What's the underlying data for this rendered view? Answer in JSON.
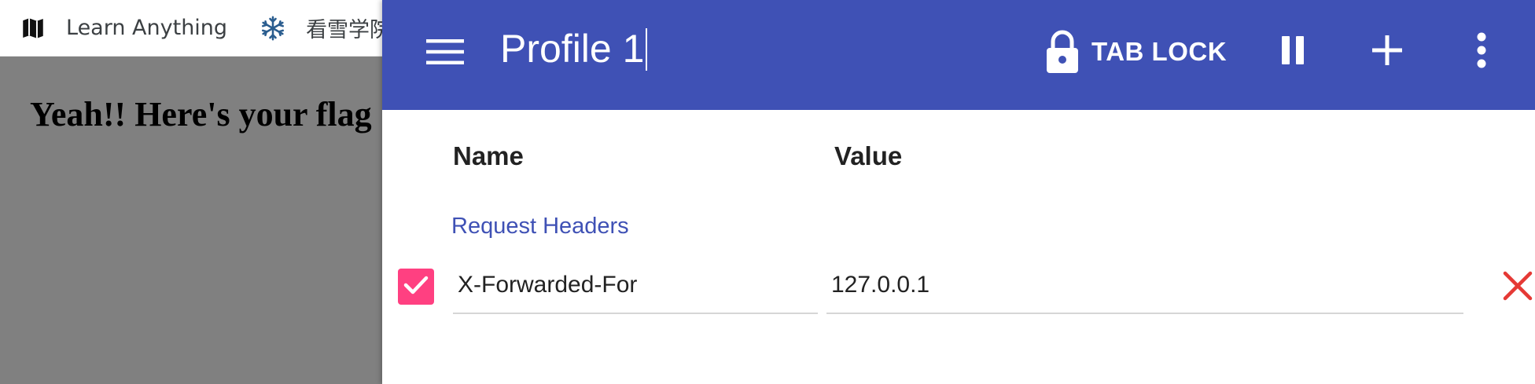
{
  "bookmarks": [
    {
      "label": "Learn Anything",
      "icon": "map-icon"
    },
    {
      "label": "看雪学院",
      "icon": "snowflake-icon"
    }
  ],
  "page": {
    "heading": "Yeah!! Here's your flag"
  },
  "popup": {
    "profile_title": "Profile 1",
    "tab_lock_label": "TAB LOCK",
    "colors": {
      "app_bar": "#3f51b5",
      "accent": "#ff4081",
      "delete": "#e53935"
    },
    "columns": {
      "name": "Name",
      "value": "Value"
    },
    "section_label": "Request Headers",
    "headers": [
      {
        "enabled": true,
        "name": "X-Forwarded-For",
        "value": "127.0.0.1"
      }
    ]
  }
}
